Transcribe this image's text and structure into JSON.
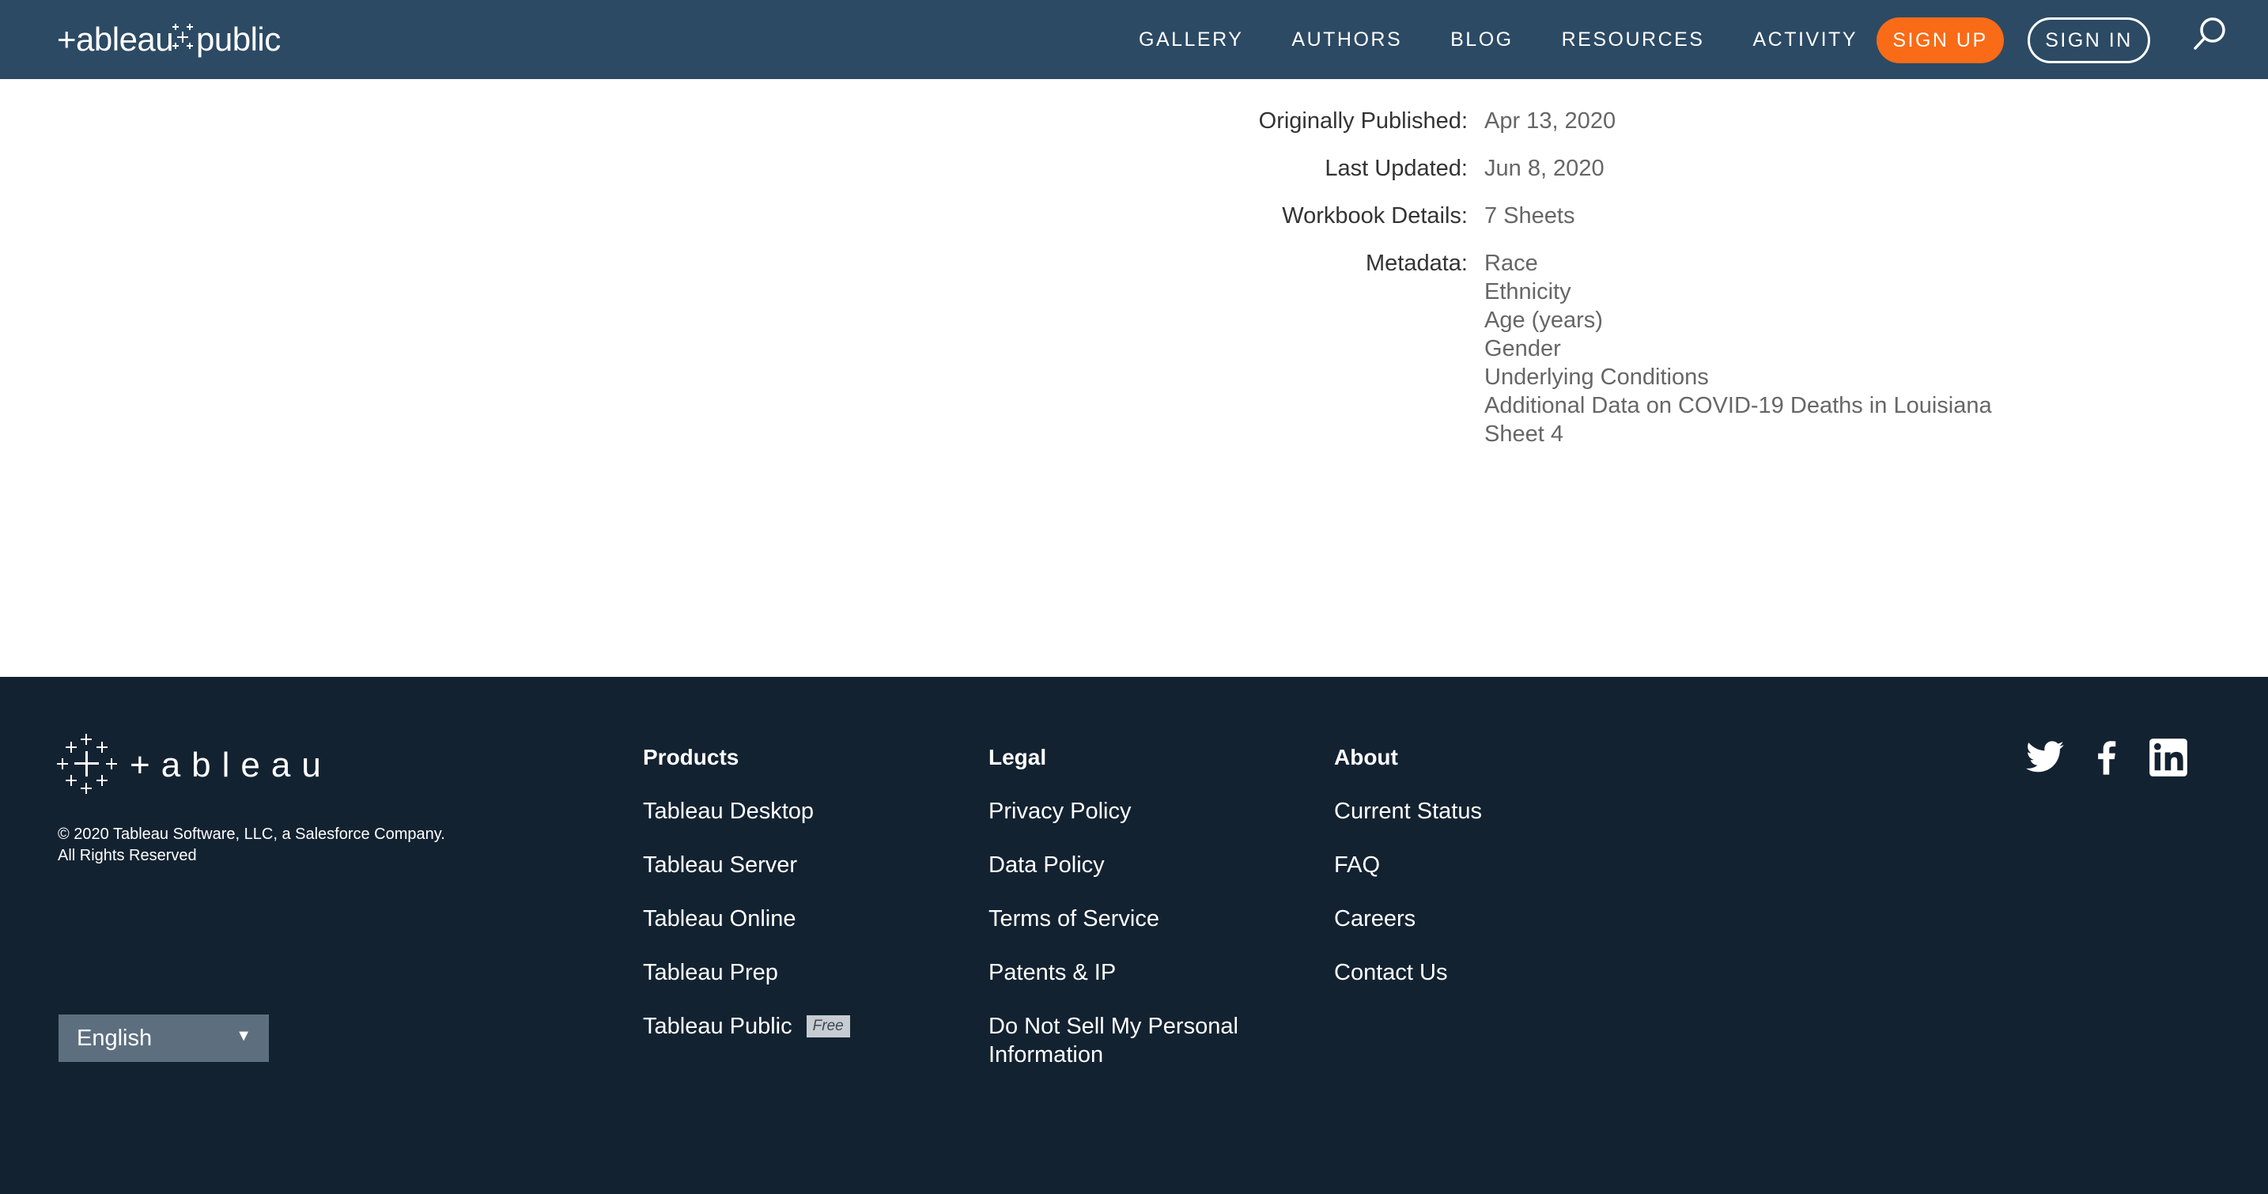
{
  "header": {
    "logo_text": "+ableau+public",
    "nav": [
      {
        "label": "GALLERY"
      },
      {
        "label": "AUTHORS"
      },
      {
        "label": "BLOG"
      },
      {
        "label": "RESOURCES"
      },
      {
        "label": "ACTIVITY"
      }
    ],
    "signup_label": "SIGN UP",
    "signin_label": "SIGN IN",
    "search_icon": "search-icon",
    "accent_color": "#f96b16",
    "nav_bg": "#2c4a64"
  },
  "details": {
    "published_label": "Originally Published:",
    "published_value": "Apr 13, 2020",
    "updated_label": "Last Updated:",
    "updated_value": "Jun 8, 2020",
    "workbook_label": "Workbook Details:",
    "workbook_value": "7 Sheets",
    "metadata_label": "Metadata:",
    "metadata_items": [
      "Race",
      "Ethnicity",
      "Age (years)",
      "Gender",
      "Underlying Conditions",
      "Additional Data on COVID-19 Deaths in Louisiana",
      "Sheet 4"
    ]
  },
  "footer": {
    "bg": "#132231",
    "logo_text": "+ableau",
    "copyright_line1": "© 2020 Tableau Software, LLC, a Salesforce Company.",
    "copyright_line2": "All Rights Reserved",
    "language": "English",
    "products": {
      "heading": "Products",
      "items": [
        "Tableau Desktop",
        "Tableau Server",
        "Tableau Online",
        "Tableau Prep",
        "Tableau Public"
      ],
      "free_badge": "Free"
    },
    "legal": {
      "heading": "Legal",
      "items": [
        "Privacy Policy",
        "Data Policy",
        "Terms of Service",
        "Patents & IP",
        "Do Not Sell My Personal Information"
      ]
    },
    "about": {
      "heading": "About",
      "items": [
        "Current Status",
        "FAQ",
        "Careers",
        "Contact Us"
      ]
    },
    "social": [
      "twitter-icon",
      "facebook-icon",
      "linkedin-icon"
    ]
  }
}
